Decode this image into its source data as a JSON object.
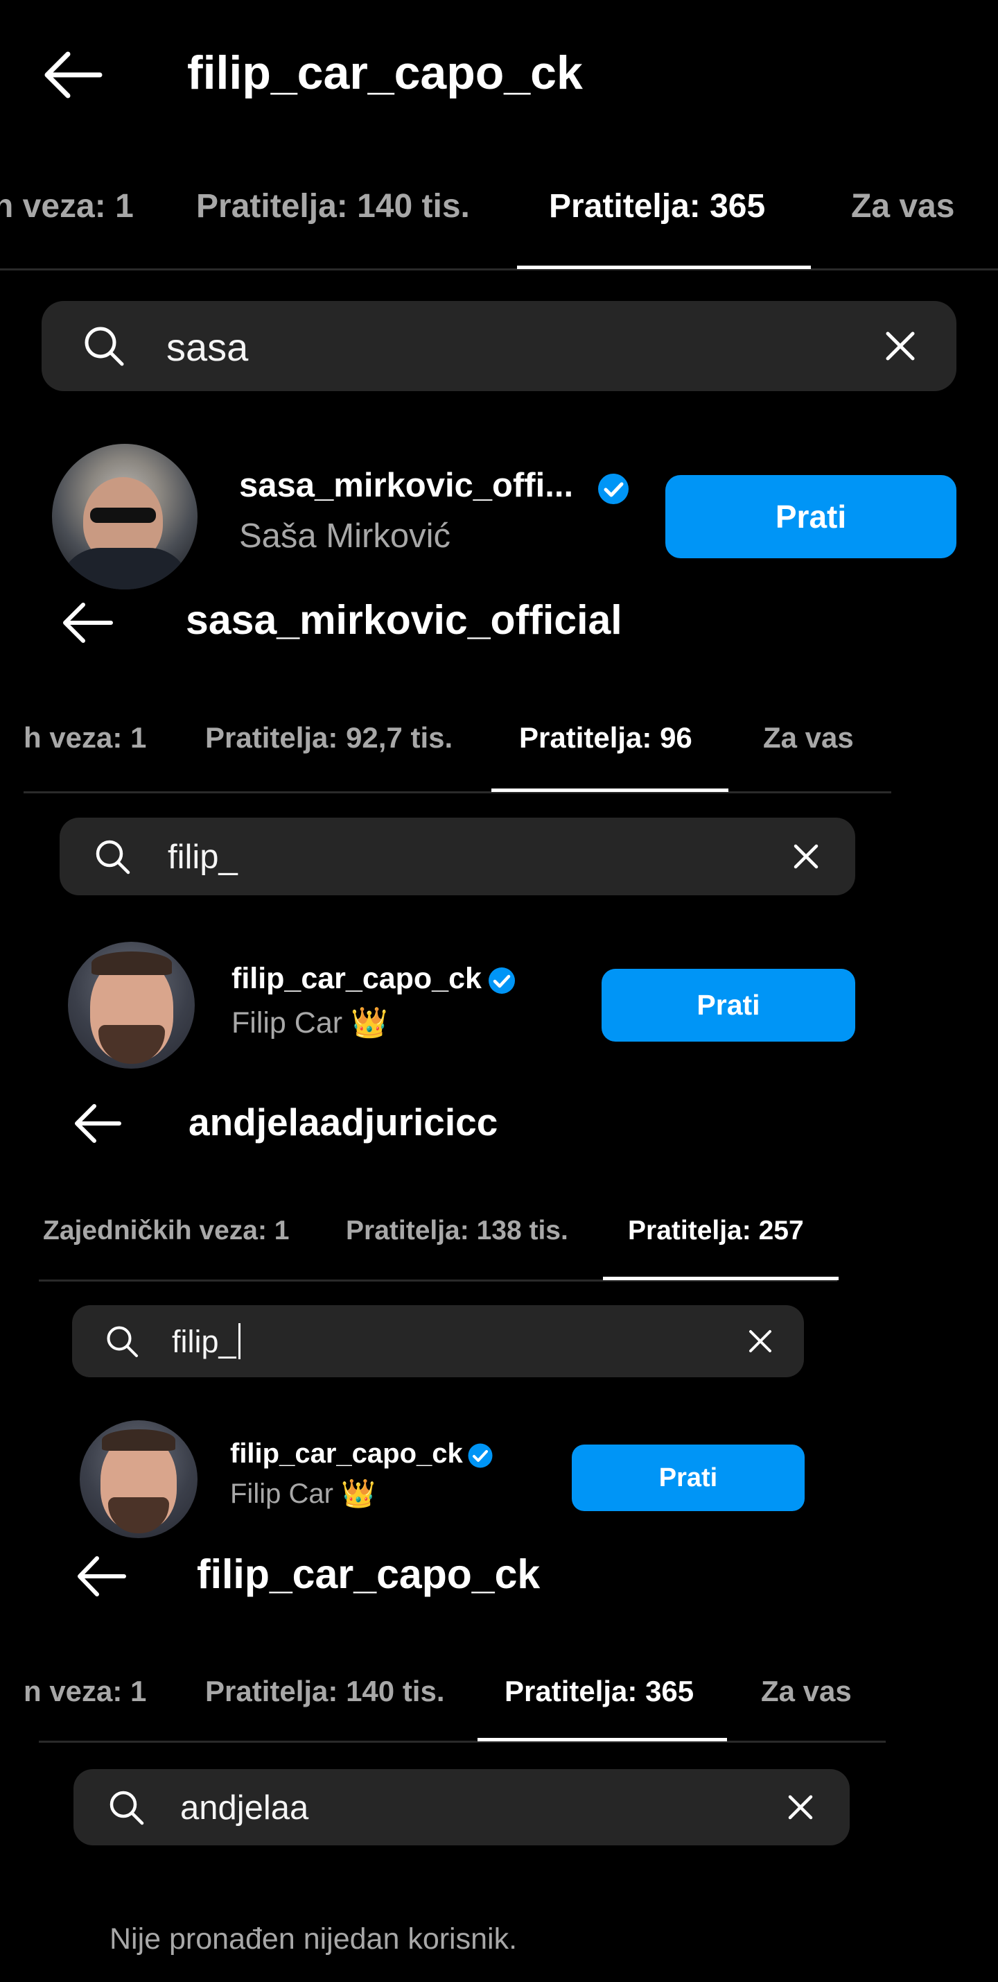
{
  "colors": {
    "background": "#000000",
    "accent": "#0095f6",
    "search_bg": "#262626",
    "muted": "#a8a8a8",
    "verified": "#0095f6"
  },
  "screens": [
    {
      "title": "filip_car_capo_ck",
      "tabs": [
        "n veza: 1",
        "Pratitelja: 140 tis.",
        "Pratitelja: 365",
        "Za vas"
      ],
      "active_tab": "Pratitelja: 365",
      "search": {
        "value": "sasa"
      },
      "result": {
        "username": "sasa_mirkovic_offi...",
        "full_name": "Saša Mirković",
        "verified": true,
        "button": "Prati"
      }
    },
    {
      "title": "sasa_mirkovic_official",
      "tabs": [
        "h veza: 1",
        "Pratitelja: 92,7 tis.",
        "Pratitelja: 96",
        "Za vas"
      ],
      "active_tab": "Pratitelja: 96",
      "search": {
        "value": "filip_"
      },
      "result": {
        "username": "filip_car_capo_ck",
        "full_name": "Filip Car 👑",
        "verified": true,
        "button": "Prati"
      }
    },
    {
      "title": "andjelaadjuricicc",
      "tabs": [
        "Zajedničkih veza: 1",
        "Pratitelja: 138 tis.",
        "Pratitelja: 257"
      ],
      "active_tab": "Pratitelja: 257",
      "search": {
        "value": "filip_"
      },
      "result": {
        "username": "filip_car_capo_ck",
        "full_name": "Filip Car 👑",
        "verified": true,
        "button": "Prati"
      }
    },
    {
      "title": "filip_car_capo_ck",
      "tabs": [
        "n veza: 1",
        "Pratitelja: 140 tis.",
        "Pratitelja: 365",
        "Za vas"
      ],
      "active_tab": "Pratitelja: 365",
      "search": {
        "value": "andjelaa"
      },
      "empty_message": "Nije pronađen nijedan korisnik."
    }
  ],
  "icons": {
    "back": "arrow-left-icon",
    "search": "search-icon",
    "clear": "close-icon",
    "verified": "verified-badge-icon"
  }
}
